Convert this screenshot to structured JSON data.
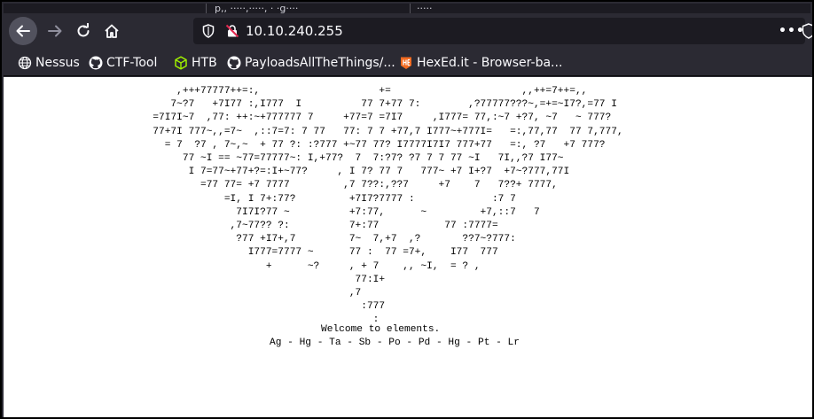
{
  "tabstrip": {
    "fragment_1": "p,, ·····,·····, · ·g····",
    "fragment_2": "·····"
  },
  "navbar": {
    "back_icon": "arrow-left-icon",
    "forward_icon": "arrow-right-icon",
    "reload_icon": "reload-icon",
    "home_icon": "home-icon",
    "url": "10.10.240.255",
    "more_icon": "three-dots-icon"
  },
  "bookmarks": [
    {
      "label": "Nessus",
      "icon": "globe-icon"
    },
    {
      "label": "CTF-Tool",
      "icon": "github-icon"
    },
    {
      "label": "HTB",
      "icon": "cube-icon"
    },
    {
      "label": "PayloadsAllTheThings/...",
      "icon": "github-icon"
    },
    {
      "label": "HexEd.it - Browser-ba...",
      "icon": "hexed-icon"
    }
  ],
  "page": {
    "ascii_art": "          ,+++77777++=:,                    +=                      ,,++=7++=,,\n         7~?7   +7I77 :,I777  I          77 7+77 7:        ,?77777???~,=+=~I7?,=77 I\n      =7I7I~7  ,77: ++:~+777777 7     +77=7 =7I7     ,I777= 77,:~7 +?7, ~7   ~ 777?\n      77+7I 777~,,=7~  ,::7=7: 7 77   77: 7 7 +77,7 I777~+777I=   =:,77,77  77 7,777,\n        = 7  ?7 , 7~,~  + 77 ?: :?777 +~77 77? I7777I7I7 777+77   =:, ?7   +7 777?\n           77 ~I == ~77=77777~: I,+77?  7  7:?7? ?7 7 7 77 ~I   7I,,?7 I77~\n            I 7=77~+77+?=:I+~77?     , I 7? 77 7   777~ +7 I+?7  +7~?777,77I\n              =77 77= +7 7777         ,7 7??:,??7     +7    7   7??+ 7777,\n                  =I, I 7+:77?         +7I7?7777 :             :7 7\n                    7I7I?77 ~          +7:77,      ~         +7,::7   7\n                   ,7~77?? ?:          7+:77           77 :7777=\n                    ?77 +I7+,7         7~  7,+7  ,?       ??7~?777:\n                      I777=7777 ~      77 :  77 =7+,    I77  777\n                         +      ~?     , + 7    ,, ~I,  = ? ,\n                                        77:I+\n                                       ,7\n                                         :777\n                                           :",
    "welcome": "Welcome to elements.",
    "elements": "Ag - Hg - Ta - Sb - Po - Pd - Hg - Pt - Lr"
  },
  "colors": {
    "toolbar": "#2b2a33",
    "urlbar": "#1c1b22",
    "page_bg": "#ffffff",
    "text": "#fbfbfe"
  }
}
